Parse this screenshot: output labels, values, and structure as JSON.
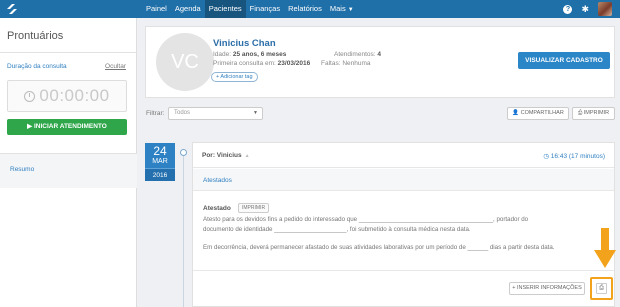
{
  "topbar": {
    "nav": [
      "Painel",
      "Agenda",
      "Pacientes",
      "Finanças",
      "Relatórios",
      "Mais"
    ],
    "active_index": 2,
    "help_icon": "question-circle-icon",
    "settings_icon": "gear-icon"
  },
  "sidebar": {
    "title": "Prontuários",
    "duration_label": "Duração da consulta",
    "hide_label": "Ocultar",
    "timer": "00:00:00",
    "start_button": "▶ INICIAR ATENDIMENTO",
    "summary_label": "Resumo"
  },
  "patient": {
    "initials": "VC",
    "name": "Vinicius Chan",
    "age_label": "Idade:",
    "age": "25 anos, 6 meses",
    "visits_label": "Atendimentos:",
    "visits": "4",
    "first_visit_label": "Primeira consulta em:",
    "first_visit": "23/03/2016",
    "absences_label": "Faltas:",
    "absences": "Nenhuma",
    "add_tag": "+ Adicionar tag",
    "view_button": "VISUALIZAR CADASTRO"
  },
  "filter": {
    "label": "Filtrar:",
    "value": "Todos",
    "share_button": "COMPARTILHAR",
    "print_button": "IMPRIMIR"
  },
  "entry": {
    "day": "24",
    "month": "MAR",
    "year": "2016",
    "author": "Por: Vinicius",
    "time": "16:43 (17 minutos)",
    "section": "Atestados",
    "doc_title": "Atestado",
    "doc_print": "IMPRIMIR",
    "line1": "Atesto para os devidos fins a pedido do interessado que _______________________________________, portador do",
    "line2": "documento de identidade _____________________, foi submetido à consulta médica nesta data.",
    "line3": "Em decorrência, deverá permanecer afastado de suas atividades laborativas por um período de ______ dias a partir desta data.",
    "insert_button": "+ INSERIR INFORMAÇÕES",
    "highlight_color": "#f3a21b"
  }
}
